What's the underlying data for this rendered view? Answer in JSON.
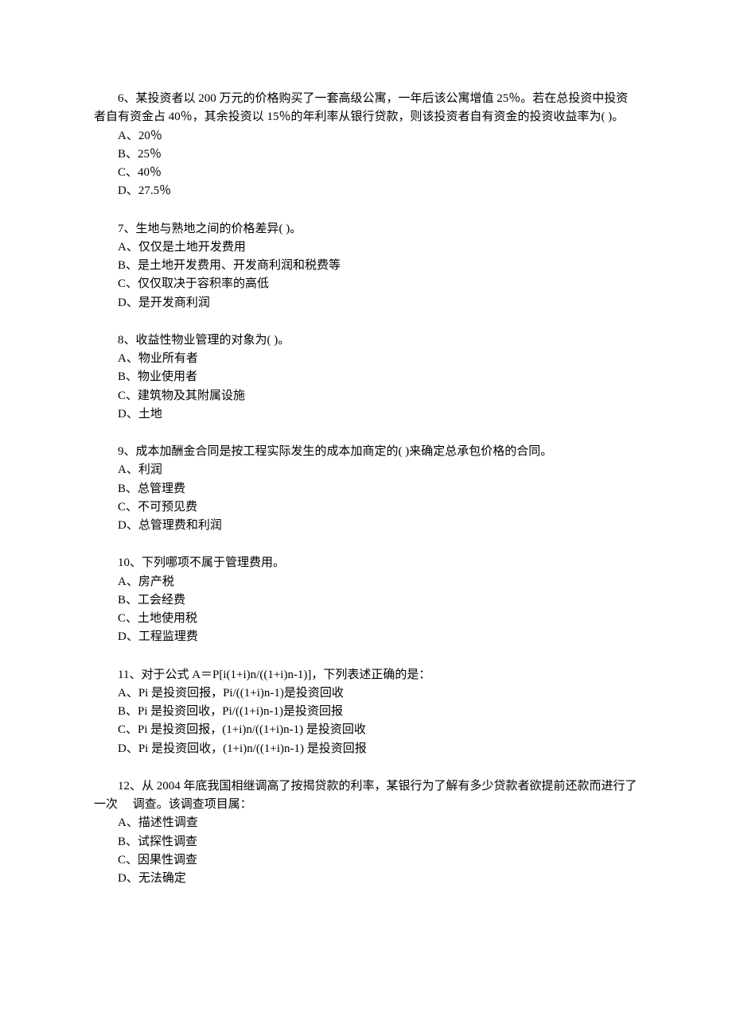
{
  "questions": [
    {
      "num": "6、",
      "text": "某投资者以 200 万元的价格购买了一套高级公寓，一年后该公寓增值 25％。若在总投资中投资者自有资金占 40％，其余投资以 15％的年利率从银行贷款，则该投资者自有资金的投资收益率为( )。",
      "options": [
        "A、20％",
        "B、25％",
        "C、40％",
        "D、27.5％"
      ]
    },
    {
      "num": "7、",
      "text": "生地与熟地之间的价格差异( )。",
      "options": [
        "A、仅仅是土地开发费用",
        "B、是土地开发费用、开发商利润和税费等",
        "C、仅仅取决于容积率的高低",
        "D、是开发商利润"
      ]
    },
    {
      "num": "8、",
      "text": "收益性物业管理的对象为( )。",
      "options": [
        "A、物业所有者",
        "B、物业使用者",
        "C、建筑物及其附属设施",
        "D、土地"
      ]
    },
    {
      "num": "9、",
      "text": "成本加酬金合同是按工程实际发生的成本加商定的( )来确定总承包价格的合同。",
      "options": [
        "A、利润",
        "B、总管理费",
        "C、不可预见费",
        "D、总管理费和利润"
      ]
    },
    {
      "num": "10、",
      "text": "下列哪项不属于管理费用。",
      "options": [
        "A、房产税",
        "B、工会经费",
        "C、土地使用税",
        "D、工程监理费"
      ]
    },
    {
      "num": "11、",
      "text": "对于公式 A＝P[i(1+i)n/((1+i)n-1)]，下列表述正确的是：",
      "options": [
        "A、Pi 是投资回报，Pi/((1+i)n-1)是投资回收",
        "B、Pi 是投资回收，Pi/((1+i)n-1)是投资回报",
        "C、Pi 是投资回报，(1+i)n/((1+i)n-1) 是投资回收",
        "D、Pi 是投资回收，(1+i)n/((1+i)n-1) 是投资回报"
      ]
    },
    {
      "num": "12、",
      "text": "从 2004 年底我国相继调高了按揭贷款的利率，某银行为了解有多少贷款者欲提前还款而进行了一次　 调查。该调查项目属：",
      "options": [
        "A、描述性调查",
        "B、试探性调查",
        "C、因果性调查",
        "D、无法确定"
      ]
    }
  ]
}
